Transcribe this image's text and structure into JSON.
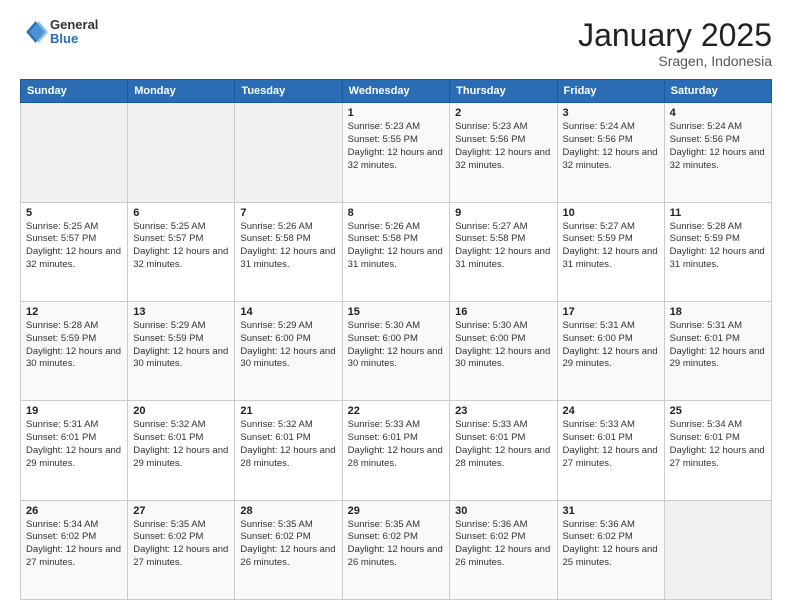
{
  "header": {
    "logo": {
      "general": "General",
      "blue": "Blue"
    },
    "title": "January 2025",
    "subtitle": "Sragen, Indonesia"
  },
  "weekdays": [
    "Sunday",
    "Monday",
    "Tuesday",
    "Wednesday",
    "Thursday",
    "Friday",
    "Saturday"
  ],
  "weeks": [
    [
      {
        "day": "",
        "sunrise": "",
        "sunset": "",
        "daylight": ""
      },
      {
        "day": "",
        "sunrise": "",
        "sunset": "",
        "daylight": ""
      },
      {
        "day": "",
        "sunrise": "",
        "sunset": "",
        "daylight": ""
      },
      {
        "day": "1",
        "sunrise": "Sunrise: 5:23 AM",
        "sunset": "Sunset: 5:55 PM",
        "daylight": "Daylight: 12 hours and 32 minutes."
      },
      {
        "day": "2",
        "sunrise": "Sunrise: 5:23 AM",
        "sunset": "Sunset: 5:56 PM",
        "daylight": "Daylight: 12 hours and 32 minutes."
      },
      {
        "day": "3",
        "sunrise": "Sunrise: 5:24 AM",
        "sunset": "Sunset: 5:56 PM",
        "daylight": "Daylight: 12 hours and 32 minutes."
      },
      {
        "day": "4",
        "sunrise": "Sunrise: 5:24 AM",
        "sunset": "Sunset: 5:56 PM",
        "daylight": "Daylight: 12 hours and 32 minutes."
      }
    ],
    [
      {
        "day": "5",
        "sunrise": "Sunrise: 5:25 AM",
        "sunset": "Sunset: 5:57 PM",
        "daylight": "Daylight: 12 hours and 32 minutes."
      },
      {
        "day": "6",
        "sunrise": "Sunrise: 5:25 AM",
        "sunset": "Sunset: 5:57 PM",
        "daylight": "Daylight: 12 hours and 32 minutes."
      },
      {
        "day": "7",
        "sunrise": "Sunrise: 5:26 AM",
        "sunset": "Sunset: 5:58 PM",
        "daylight": "Daylight: 12 hours and 31 minutes."
      },
      {
        "day": "8",
        "sunrise": "Sunrise: 5:26 AM",
        "sunset": "Sunset: 5:58 PM",
        "daylight": "Daylight: 12 hours and 31 minutes."
      },
      {
        "day": "9",
        "sunrise": "Sunrise: 5:27 AM",
        "sunset": "Sunset: 5:58 PM",
        "daylight": "Daylight: 12 hours and 31 minutes."
      },
      {
        "day": "10",
        "sunrise": "Sunrise: 5:27 AM",
        "sunset": "Sunset: 5:59 PM",
        "daylight": "Daylight: 12 hours and 31 minutes."
      },
      {
        "day": "11",
        "sunrise": "Sunrise: 5:28 AM",
        "sunset": "Sunset: 5:59 PM",
        "daylight": "Daylight: 12 hours and 31 minutes."
      }
    ],
    [
      {
        "day": "12",
        "sunrise": "Sunrise: 5:28 AM",
        "sunset": "Sunset: 5:59 PM",
        "daylight": "Daylight: 12 hours and 30 minutes."
      },
      {
        "day": "13",
        "sunrise": "Sunrise: 5:29 AM",
        "sunset": "Sunset: 5:59 PM",
        "daylight": "Daylight: 12 hours and 30 minutes."
      },
      {
        "day": "14",
        "sunrise": "Sunrise: 5:29 AM",
        "sunset": "Sunset: 6:00 PM",
        "daylight": "Daylight: 12 hours and 30 minutes."
      },
      {
        "day": "15",
        "sunrise": "Sunrise: 5:30 AM",
        "sunset": "Sunset: 6:00 PM",
        "daylight": "Daylight: 12 hours and 30 minutes."
      },
      {
        "day": "16",
        "sunrise": "Sunrise: 5:30 AM",
        "sunset": "Sunset: 6:00 PM",
        "daylight": "Daylight: 12 hours and 30 minutes."
      },
      {
        "day": "17",
        "sunrise": "Sunrise: 5:31 AM",
        "sunset": "Sunset: 6:00 PM",
        "daylight": "Daylight: 12 hours and 29 minutes."
      },
      {
        "day": "18",
        "sunrise": "Sunrise: 5:31 AM",
        "sunset": "Sunset: 6:01 PM",
        "daylight": "Daylight: 12 hours and 29 minutes."
      }
    ],
    [
      {
        "day": "19",
        "sunrise": "Sunrise: 5:31 AM",
        "sunset": "Sunset: 6:01 PM",
        "daylight": "Daylight: 12 hours and 29 minutes."
      },
      {
        "day": "20",
        "sunrise": "Sunrise: 5:32 AM",
        "sunset": "Sunset: 6:01 PM",
        "daylight": "Daylight: 12 hours and 29 minutes."
      },
      {
        "day": "21",
        "sunrise": "Sunrise: 5:32 AM",
        "sunset": "Sunset: 6:01 PM",
        "daylight": "Daylight: 12 hours and 28 minutes."
      },
      {
        "day": "22",
        "sunrise": "Sunrise: 5:33 AM",
        "sunset": "Sunset: 6:01 PM",
        "daylight": "Daylight: 12 hours and 28 minutes."
      },
      {
        "day": "23",
        "sunrise": "Sunrise: 5:33 AM",
        "sunset": "Sunset: 6:01 PM",
        "daylight": "Daylight: 12 hours and 28 minutes."
      },
      {
        "day": "24",
        "sunrise": "Sunrise: 5:33 AM",
        "sunset": "Sunset: 6:01 PM",
        "daylight": "Daylight: 12 hours and 27 minutes."
      },
      {
        "day": "25",
        "sunrise": "Sunrise: 5:34 AM",
        "sunset": "Sunset: 6:01 PM",
        "daylight": "Daylight: 12 hours and 27 minutes."
      }
    ],
    [
      {
        "day": "26",
        "sunrise": "Sunrise: 5:34 AM",
        "sunset": "Sunset: 6:02 PM",
        "daylight": "Daylight: 12 hours and 27 minutes."
      },
      {
        "day": "27",
        "sunrise": "Sunrise: 5:35 AM",
        "sunset": "Sunset: 6:02 PM",
        "daylight": "Daylight: 12 hours and 27 minutes."
      },
      {
        "day": "28",
        "sunrise": "Sunrise: 5:35 AM",
        "sunset": "Sunset: 6:02 PM",
        "daylight": "Daylight: 12 hours and 26 minutes."
      },
      {
        "day": "29",
        "sunrise": "Sunrise: 5:35 AM",
        "sunset": "Sunset: 6:02 PM",
        "daylight": "Daylight: 12 hours and 26 minutes."
      },
      {
        "day": "30",
        "sunrise": "Sunrise: 5:36 AM",
        "sunset": "Sunset: 6:02 PM",
        "daylight": "Daylight: 12 hours and 26 minutes."
      },
      {
        "day": "31",
        "sunrise": "Sunrise: 5:36 AM",
        "sunset": "Sunset: 6:02 PM",
        "daylight": "Daylight: 12 hours and 25 minutes."
      },
      {
        "day": "",
        "sunrise": "",
        "sunset": "",
        "daylight": ""
      }
    ]
  ]
}
